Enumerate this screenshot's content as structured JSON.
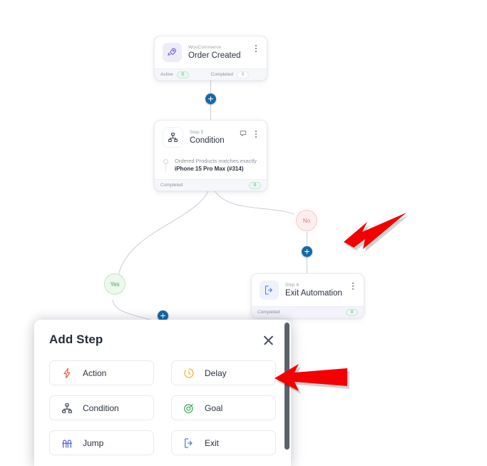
{
  "canvas": {
    "nodes": [
      {
        "id": "order-created",
        "icon": "rocket-icon",
        "subtitle": "WooCommerce",
        "title": "Order Created",
        "stats": [
          {
            "label": "Active",
            "value": "0",
            "style": "green"
          },
          {
            "label": "Completed",
            "value": "0",
            "style": "white"
          }
        ]
      },
      {
        "id": "condition",
        "icon": "sitemap-icon",
        "subtitle": "Step 5",
        "title": "Condition",
        "condition_line1": "Ordered Products matches exactly",
        "condition_line2": "iPhone 15 Pro Max (#314)",
        "stats": [
          {
            "label": "Completed",
            "value": "0",
            "style": "green"
          }
        ]
      },
      {
        "id": "exit-automation",
        "icon": "exit-door-icon",
        "subtitle": "Step 6",
        "title": "Exit Automation",
        "stats": [
          {
            "label": "Completed",
            "value": "0",
            "style": "green"
          }
        ]
      }
    ],
    "branches": [
      {
        "id": "yes",
        "label": "Yes",
        "style": "green"
      },
      {
        "id": "no",
        "label": "No",
        "style": "red"
      }
    ],
    "add_buttons": 3,
    "colors": {
      "plus_button": "#1569a8",
      "branch_yes": "#4aa159",
      "branch_no": "#dd7575",
      "connector_line": "#c9ccd4",
      "annotation_arrow": "#f40000"
    }
  },
  "add_step_modal": {
    "title": "Add Step",
    "close_label": "close-icon",
    "options": [
      {
        "label": "Action",
        "icon": "lightning-bolt-icon",
        "color": "#ea5b3a"
      },
      {
        "label": "Delay",
        "icon": "clock-icon",
        "color": "#f0b429"
      },
      {
        "label": "Condition",
        "icon": "sitemap-icon",
        "color": "#3b4252"
      },
      {
        "label": "Goal",
        "icon": "target-icon",
        "color": "#3faa55"
      },
      {
        "label": "Jump",
        "icon": "jump-icon",
        "color": "#4a5ce0"
      },
      {
        "label": "Exit",
        "icon": "exit-door-icon",
        "color": "#4a7ce0"
      }
    ]
  }
}
